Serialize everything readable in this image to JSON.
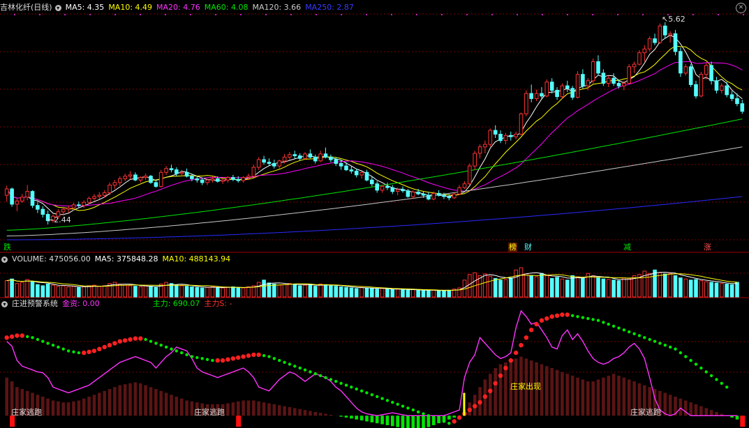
{
  "header_main": {
    "title": "吉林化纤(日线)",
    "ma5": "MA5: 4.35",
    "ma10": "MA10: 4.49",
    "ma20": "MA20: 4.76",
    "ma60": "MA60: 4.08",
    "ma120": "MA120: 3.66",
    "ma250": "MA250: 2.87"
  },
  "header_volume": {
    "title": "VOLUME: 475056.00",
    "ma5": "MA5: 375848.28",
    "ma10": "MA10: 488143.94"
  },
  "header_indicator": {
    "title": "庄进预警系统",
    "jinzi": "金资: 0.00",
    "zhuli": "主力: 690.07",
    "zhulis": "主力S: -"
  },
  "labels": {
    "high": "5.62",
    "low": "2.44",
    "tag_die": "跌",
    "tag_bang": "榜",
    "tag_cai": "财",
    "tag_jian": "减",
    "tag_zhang": "涨",
    "signal_appear": "庄家出现",
    "signal_escape_1": "庄家逃跑",
    "signal_escape_2": "庄家逃跑",
    "signal_escape_3": "庄家逃跑"
  },
  "colors": {
    "up": "#ff3232",
    "down": "#54ffff",
    "ma5": "#ffffff",
    "ma10": "#ffff00",
    "ma20": "#ff00ff",
    "ma60": "#00e600",
    "ma120": "#c8c8c8",
    "ma250": "#2a2aff",
    "grid": "#7a0000"
  },
  "chart_data": {
    "type": "candlestick",
    "price_axis_range": [
      2.2,
      5.75
    ],
    "price_range_note_values": {
      "high": 5.62,
      "low": 2.44
    },
    "candles": [
      [
        2.9,
        3.05,
        2.8,
        3.0
      ],
      [
        3.0,
        3.02,
        2.72,
        2.76
      ],
      [
        2.76,
        2.85,
        2.65,
        2.81
      ],
      [
        2.81,
        2.92,
        2.78,
        2.87
      ],
      [
        2.87,
        3.06,
        2.82,
        2.96
      ],
      [
        2.96,
        2.98,
        2.7,
        2.74
      ],
      [
        2.74,
        2.8,
        2.62,
        2.68
      ],
      [
        2.68,
        2.73,
        2.55,
        2.6
      ],
      [
        2.6,
        2.66,
        2.44,
        2.5
      ],
      [
        2.5,
        2.6,
        2.47,
        2.57
      ],
      [
        2.57,
        2.68,
        2.53,
        2.64
      ],
      [
        2.64,
        2.72,
        2.58,
        2.68
      ],
      [
        2.68,
        2.74,
        2.62,
        2.7
      ],
      [
        2.7,
        2.78,
        2.66,
        2.75
      ],
      [
        2.75,
        2.8,
        2.7,
        2.74
      ],
      [
        2.74,
        2.82,
        2.7,
        2.79
      ],
      [
        2.79,
        2.88,
        2.76,
        2.85
      ],
      [
        2.85,
        2.92,
        2.82,
        2.88
      ],
      [
        2.88,
        2.95,
        2.84,
        2.9
      ],
      [
        2.9,
        2.98,
        2.86,
        2.94
      ],
      [
        2.94,
        3.1,
        2.9,
        3.06
      ],
      [
        3.06,
        3.14,
        3.0,
        3.1
      ],
      [
        3.1,
        3.2,
        3.05,
        3.16
      ],
      [
        3.16,
        3.24,
        3.12,
        3.2
      ],
      [
        3.2,
        3.28,
        3.15,
        3.22
      ],
      [
        3.22,
        3.26,
        3.12,
        3.14
      ],
      [
        3.14,
        3.2,
        3.1,
        3.18
      ],
      [
        3.18,
        3.24,
        3.14,
        3.2
      ],
      [
        3.2,
        3.22,
        3.08,
        3.1
      ],
      [
        3.1,
        3.15,
        3.02,
        3.04
      ],
      [
        3.04,
        3.3,
        3.02,
        3.26
      ],
      [
        3.26,
        3.36,
        3.22,
        3.32
      ],
      [
        3.32,
        3.38,
        3.26,
        3.3
      ],
      [
        3.3,
        3.34,
        3.2,
        3.24
      ],
      [
        3.24,
        3.3,
        3.2,
        3.26
      ],
      [
        3.26,
        3.32,
        3.18,
        3.2
      ],
      [
        3.2,
        3.24,
        3.12,
        3.16
      ],
      [
        3.16,
        3.2,
        3.1,
        3.14
      ],
      [
        3.14,
        3.18,
        3.06,
        3.1
      ],
      [
        3.1,
        3.16,
        3.06,
        3.14
      ],
      [
        3.14,
        3.2,
        3.1,
        3.16
      ],
      [
        3.16,
        3.2,
        3.1,
        3.12
      ],
      [
        3.12,
        3.16,
        3.08,
        3.14
      ],
      [
        3.14,
        3.2,
        3.1,
        3.18
      ],
      [
        3.18,
        3.22,
        3.12,
        3.15
      ],
      [
        3.15,
        3.2,
        3.1,
        3.13
      ],
      [
        3.13,
        3.2,
        3.1,
        3.18
      ],
      [
        3.18,
        3.24,
        3.14,
        3.2
      ],
      [
        3.2,
        3.38,
        3.18,
        3.34
      ],
      [
        3.34,
        3.5,
        3.3,
        3.46
      ],
      [
        3.46,
        3.52,
        3.38,
        3.42
      ],
      [
        3.42,
        3.48,
        3.36,
        3.4
      ],
      [
        3.4,
        3.46,
        3.32,
        3.36
      ],
      [
        3.36,
        3.46,
        3.32,
        3.44
      ],
      [
        3.44,
        3.55,
        3.4,
        3.5
      ],
      [
        3.5,
        3.58,
        3.45,
        3.54
      ],
      [
        3.54,
        3.6,
        3.48,
        3.52
      ],
      [
        3.52,
        3.56,
        3.44,
        3.48
      ],
      [
        3.48,
        3.58,
        3.46,
        3.55
      ],
      [
        3.55,
        3.62,
        3.48,
        3.5
      ],
      [
        3.5,
        3.54,
        3.4,
        3.44
      ],
      [
        3.44,
        3.6,
        3.42,
        3.55
      ],
      [
        3.55,
        3.65,
        3.48,
        3.5
      ],
      [
        3.5,
        3.54,
        3.42,
        3.46
      ],
      [
        3.46,
        3.5,
        3.36,
        3.4
      ],
      [
        3.4,
        3.46,
        3.3,
        3.36
      ],
      [
        3.36,
        3.42,
        3.28,
        3.3
      ],
      [
        3.3,
        3.36,
        3.24,
        3.28
      ],
      [
        3.28,
        3.32,
        3.18,
        3.22
      ],
      [
        3.22,
        3.28,
        3.16,
        3.26
      ],
      [
        3.26,
        3.3,
        3.12,
        3.14
      ],
      [
        3.14,
        3.2,
        3.04,
        3.08
      ],
      [
        3.08,
        3.12,
        2.94,
        2.98
      ],
      [
        2.98,
        3.06,
        2.94,
        3.04
      ],
      [
        3.04,
        3.1,
        2.98,
        3.02
      ],
      [
        3.02,
        3.06,
        2.92,
        2.96
      ],
      [
        2.96,
        3.02,
        2.9,
        2.99
      ],
      [
        2.99,
        3.04,
        2.94,
        2.97
      ],
      [
        2.97,
        3.0,
        2.86,
        2.88
      ],
      [
        2.88,
        2.98,
        2.84,
        2.95
      ],
      [
        2.95,
        3.0,
        2.9,
        2.92
      ],
      [
        2.92,
        2.96,
        2.86,
        2.9
      ],
      [
        2.9,
        2.95,
        2.82,
        2.84
      ],
      [
        2.84,
        2.96,
        2.82,
        2.93
      ],
      [
        2.93,
        2.98,
        2.88,
        2.9
      ],
      [
        2.9,
        2.94,
        2.84,
        2.88
      ],
      [
        2.88,
        2.92,
        2.82,
        2.86
      ],
      [
        2.86,
        2.94,
        2.84,
        2.92
      ],
      [
        2.92,
        3.06,
        2.9,
        3.02
      ],
      [
        3.02,
        3.12,
        3.0,
        3.08
      ],
      [
        3.08,
        3.4,
        3.06,
        3.36
      ],
      [
        3.36,
        3.6,
        3.3,
        3.56
      ],
      [
        3.56,
        3.7,
        3.48,
        3.66
      ],
      [
        3.66,
        3.76,
        3.56,
        3.7
      ],
      [
        3.7,
        3.95,
        3.66,
        3.92
      ],
      [
        3.92,
        4.0,
        3.8,
        3.86
      ],
      [
        3.86,
        3.92,
        3.72,
        3.76
      ],
      [
        3.76,
        3.88,
        3.7,
        3.84
      ],
      [
        3.84,
        3.9,
        3.76,
        3.82
      ],
      [
        3.82,
        3.9,
        3.78,
        3.86
      ],
      [
        3.86,
        4.2,
        3.84,
        4.18
      ],
      [
        4.18,
        4.55,
        4.14,
        4.5
      ],
      [
        4.5,
        4.64,
        4.36,
        4.42
      ],
      [
        4.42,
        4.56,
        4.38,
        4.5
      ],
      [
        4.5,
        4.6,
        4.42,
        4.46
      ],
      [
        4.46,
        4.72,
        4.44,
        4.68
      ],
      [
        4.68,
        4.74,
        4.5,
        4.55
      ],
      [
        4.55,
        4.6,
        4.4,
        4.45
      ],
      [
        4.45,
        4.66,
        4.42,
        4.62
      ],
      [
        4.62,
        4.7,
        4.52,
        4.58
      ],
      [
        4.58,
        4.62,
        4.4,
        4.44
      ],
      [
        4.44,
        4.85,
        4.42,
        4.8
      ],
      [
        4.8,
        4.88,
        4.58,
        4.62
      ],
      [
        4.62,
        4.74,
        4.55,
        4.7
      ],
      [
        4.7,
        5.05,
        4.66,
        5.0
      ],
      [
        5.0,
        5.1,
        4.78,
        4.82
      ],
      [
        4.82,
        4.88,
        4.62,
        4.66
      ],
      [
        4.66,
        4.78,
        4.6,
        4.74
      ],
      [
        4.74,
        4.82,
        4.62,
        4.66
      ],
      [
        4.66,
        4.72,
        4.58,
        4.62
      ],
      [
        4.62,
        4.7,
        4.55,
        4.66
      ],
      [
        4.66,
        4.96,
        4.64,
        4.92
      ],
      [
        4.92,
        5.0,
        4.82,
        4.96
      ],
      [
        4.96,
        5.18,
        4.94,
        5.14
      ],
      [
        5.14,
        5.26,
        5.0,
        5.2
      ],
      [
        5.2,
        5.4,
        5.16,
        5.36
      ],
      [
        5.36,
        5.44,
        5.26,
        5.3
      ],
      [
        5.3,
        5.6,
        5.28,
        5.56
      ],
      [
        5.56,
        5.62,
        5.36,
        5.42
      ],
      [
        5.42,
        5.48,
        5.3,
        5.44
      ],
      [
        5.44,
        5.5,
        5.1,
        5.16
      ],
      [
        5.16,
        5.22,
        4.76,
        4.82
      ],
      [
        4.82,
        4.96,
        4.78,
        4.92
      ],
      [
        4.92,
        4.96,
        4.6,
        4.64
      ],
      [
        4.64,
        4.7,
        4.42,
        4.46
      ],
      [
        4.46,
        4.84,
        4.44,
        4.8
      ],
      [
        4.8,
        4.98,
        4.72,
        4.94
      ],
      [
        4.94,
        5.0,
        4.64,
        4.7
      ],
      [
        4.7,
        4.76,
        4.5,
        4.55
      ],
      [
        4.55,
        4.66,
        4.5,
        4.62
      ],
      [
        4.62,
        4.68,
        4.44,
        4.48
      ],
      [
        4.48,
        4.54,
        4.38,
        4.42
      ],
      [
        4.42,
        4.5,
        4.3,
        4.34
      ],
      [
        4.34,
        4.4,
        4.18,
        4.22
      ]
    ],
    "volume": [
      290,
      320,
      240,
      260,
      310,
      280,
      220,
      200,
      230,
      210,
      190,
      200,
      180,
      190,
      170,
      180,
      200,
      210,
      190,
      200,
      240,
      260,
      230,
      210,
      200,
      190,
      180,
      200,
      190,
      170,
      230,
      260,
      240,
      210,
      200,
      190,
      180,
      170,
      160,
      170,
      180,
      170,
      160,
      170,
      180,
      170,
      160,
      180,
      200,
      260,
      300,
      250,
      230,
      210,
      220,
      240,
      230,
      200,
      210,
      220,
      190,
      230,
      220,
      200,
      190,
      180,
      170,
      160,
      150,
      170,
      160,
      150,
      140,
      150,
      140,
      130,
      140,
      130,
      120,
      130,
      120,
      110,
      120,
      120,
      110,
      110,
      120,
      140,
      160,
      300,
      400,
      430,
      380,
      410,
      370,
      330,
      300,
      310,
      340,
      480,
      520,
      410,
      380,
      360,
      420,
      380,
      330,
      350,
      320,
      300,
      380,
      360,
      330,
      420,
      380,
      340,
      320,
      310,
      300,
      290,
      340,
      330,
      380,
      400,
      460,
      420,
      480,
      430,
      410,
      420,
      380,
      340,
      320,
      300,
      310,
      290,
      270,
      260,
      250,
      240,
      230,
      220,
      260
    ],
    "indicator_range": [
      -10,
      110
    ],
    "zhuli_line": [
      78,
      73,
      58,
      52,
      50,
      48,
      46,
      45,
      40,
      30,
      28,
      26,
      24,
      26,
      28,
      30,
      32,
      36,
      40,
      44,
      48,
      52,
      56,
      58,
      60,
      62,
      60,
      58,
      56,
      50,
      56,
      62,
      66,
      72,
      70,
      68,
      60,
      50,
      46,
      44,
      42,
      40,
      42,
      44,
      46,
      48,
      50,
      46,
      40,
      30,
      28,
      26,
      32,
      38,
      42,
      46,
      44,
      40,
      36,
      40,
      44,
      42,
      40,
      36,
      30,
      26,
      20,
      14,
      8,
      4,
      2,
      1,
      0,
      1,
      2,
      3,
      2,
      1,
      0,
      0,
      0,
      0,
      0,
      0,
      0,
      0,
      2,
      4,
      6,
      40,
      56,
      64,
      82,
      76,
      70,
      64,
      60,
      62,
      66,
      92,
      110,
      104,
      96,
      98,
      90,
      82,
      72,
      70,
      84,
      90,
      80,
      86,
      78,
      68,
      60,
      56,
      54,
      56,
      60,
      62,
      66,
      72,
      76,
      70,
      60,
      40,
      18,
      6,
      2,
      0,
      2,
      8,
      4,
      0,
      0,
      0,
      0,
      0,
      0,
      0,
      0,
      0,
      0
    ],
    "jinzi_line": [
      82,
      83,
      84,
      84,
      83,
      82,
      80,
      78,
      76,
      74,
      72,
      70,
      68,
      67,
      66,
      66,
      67,
      68,
      70,
      72,
      74,
      76,
      78,
      79,
      80,
      81,
      81,
      80,
      78,
      76,
      74,
      72,
      70,
      68,
      66,
      64,
      62,
      61,
      60,
      59,
      58,
      58,
      58,
      59,
      60,
      61,
      62,
      63,
      64,
      64,
      63,
      62,
      60,
      58,
      56,
      54,
      52,
      50,
      48,
      46,
      44,
      42,
      40,
      38,
      36,
      34,
      32,
      30,
      28,
      26,
      24,
      22,
      20,
      18,
      16,
      14,
      12,
      10,
      8,
      6,
      4,
      2,
      0,
      -2,
      -4,
      -6,
      -8,
      -6,
      -2,
      2,
      6,
      10,
      14,
      20,
      26,
      34,
      42,
      50,
      58,
      66,
      74,
      82,
      90,
      96,
      100,
      102,
      104,
      105,
      106,
      106,
      105,
      104,
      103,
      102,
      101,
      100,
      98,
      96,
      94,
      92,
      90,
      88,
      86,
      84,
      82,
      80,
      78,
      76,
      74,
      72,
      70,
      66,
      62,
      58,
      54,
      50,
      46,
      42,
      38,
      34,
      30
    ],
    "bars_histogram": [
      40,
      36,
      30,
      28,
      26,
      24,
      22,
      20,
      18,
      16,
      15,
      14,
      14,
      15,
      16,
      18,
      20,
      22,
      24,
      26,
      28,
      30,
      32,
      33,
      34,
      35,
      34,
      32,
      30,
      28,
      26,
      24,
      22,
      20,
      18,
      16,
      15,
      14,
      13,
      12,
      12,
      12,
      12,
      13,
      14,
      15,
      16,
      16,
      16,
      15,
      14,
      13,
      12,
      11,
      10,
      9,
      8,
      7,
      6,
      5,
      4,
      3,
      2,
      1,
      0,
      -1,
      -2,
      -3,
      -4,
      -5,
      -6,
      -7,
      -8,
      -9,
      -10,
      -11,
      -12,
      -13,
      -14,
      -14,
      -14,
      -13,
      -12,
      -10,
      -8,
      -6,
      -4,
      -2,
      0,
      6,
      14,
      22,
      30,
      38,
      44,
      50,
      54,
      56,
      58,
      60,
      62,
      60,
      58,
      56,
      54,
      52,
      50,
      48,
      46,
      44,
      42,
      40,
      38,
      36,
      36,
      38,
      40,
      42,
      44,
      42,
      40,
      38,
      36,
      34,
      32,
      30,
      28,
      26,
      24,
      22,
      20,
      18,
      16,
      14,
      12,
      10,
      8,
      6,
      4,
      2,
      0,
      -2,
      -4
    ]
  }
}
